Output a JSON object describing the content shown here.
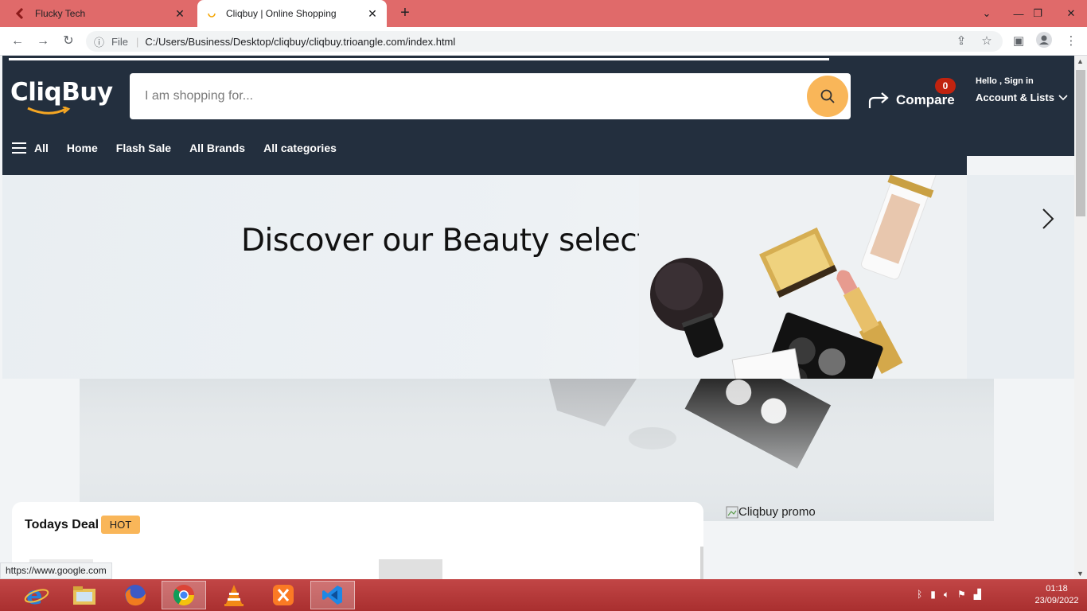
{
  "browser": {
    "tabs": [
      {
        "title": "Flucky Tech",
        "active": false
      },
      {
        "title": "Cliqbuy | Online Shopping",
        "active": true
      }
    ],
    "nav": {
      "file_label": "File",
      "url": "C:/Users/Business/Desktop/cliqbuy/cliqbuy.trioangle.com/index.html"
    },
    "status_url": "https://www.google.com"
  },
  "site": {
    "logo": "CliqBuy",
    "search": {
      "placeholder": "I am shopping for..."
    },
    "compare_label": "Compare",
    "compare_count": "0",
    "account": {
      "hello": "Hello , Sign in",
      "lists": "Account & Lists"
    },
    "nav_items": [
      "All",
      "Home",
      "Flash Sale",
      "All Brands",
      "All categories"
    ],
    "banner": {
      "title": "Discover our Beauty selection"
    },
    "promo_alt": "Cliqbuy promo",
    "deal": {
      "title": "Todays Deal",
      "badge": "HOT"
    }
  },
  "taskbar": {
    "apps": [
      "internet-explorer",
      "file-explorer",
      "firefox",
      "chrome",
      "vlc",
      "xampp",
      "vscode"
    ],
    "clock": {
      "time": "01:18",
      "date": "23/09/2022"
    }
  },
  "colors": {
    "header": "#232f3e",
    "accent": "#f9b659",
    "badge": "#c0230f",
    "tabstrip": "#e06a6a"
  }
}
